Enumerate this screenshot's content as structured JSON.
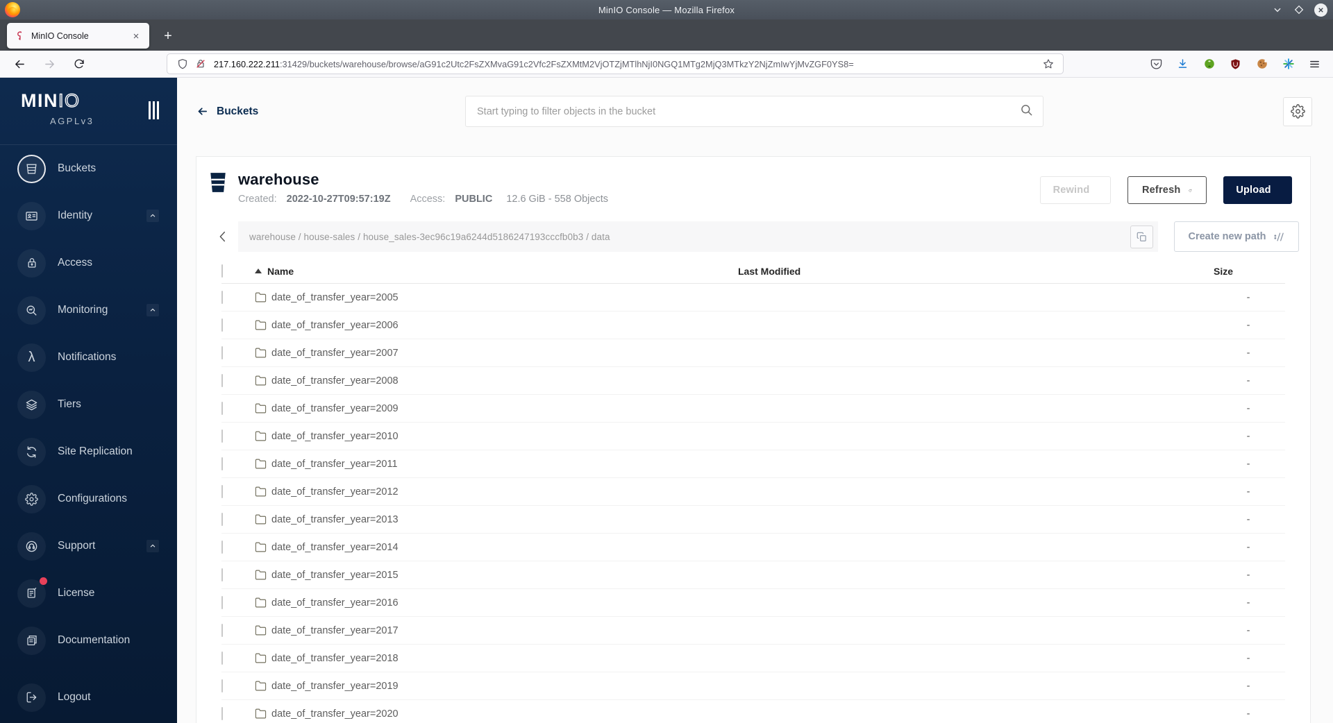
{
  "window": {
    "title": "MinIO Console — Mozilla Firefox"
  },
  "browser": {
    "tab_title": "MinIO Console",
    "new_tab_label": "+",
    "url_host": "217.160.222.211",
    "url_rest": ":31429/buckets/warehouse/browse/aG91c2Utc2FsZXMvaG91c2Vfc2FsZXMtM2VjOTZjMTlhNjI0NGQ1MTg2MjQ3MTkzY2NjZmIwYjMvZGF0YS8="
  },
  "sidebar": {
    "logo_primary": "MIN",
    "logo_secondary": "IO",
    "license_tag": "AGPLv3",
    "lambda_glyph": "λ",
    "items": [
      {
        "label": "Buckets"
      },
      {
        "label": "Identity"
      },
      {
        "label": "Access"
      },
      {
        "label": "Monitoring"
      },
      {
        "label": "Notifications"
      },
      {
        "label": "Tiers"
      },
      {
        "label": "Site Replication"
      },
      {
        "label": "Configurations"
      },
      {
        "label": "Support"
      },
      {
        "label": "License"
      },
      {
        "label": "Documentation"
      },
      {
        "label": "Logout"
      }
    ]
  },
  "topbar": {
    "back_label": "Buckets",
    "search_placeholder": "Start typing to filter objects in the bucket"
  },
  "bucket": {
    "name": "warehouse",
    "created_label": "Created:",
    "created_value": "2022-10-27T09:57:19Z",
    "access_label": "Access:",
    "access_value": "PUBLIC",
    "summary": "12.6 GiB - 558 Objects",
    "rewind_label": "Rewind",
    "refresh_label": "Refresh",
    "upload_label": "Upload"
  },
  "browse": {
    "path": "warehouse / house-sales / house_sales-3ec96c19a6244d5186247193cccfb0b3 / data",
    "create_path_label": "Create new path"
  },
  "objects_table": {
    "col_name": "Name",
    "col_modified": "Last Modified",
    "col_size": "Size",
    "rows": [
      {
        "name": "date_of_transfer_year=2005",
        "size": "-"
      },
      {
        "name": "date_of_transfer_year=2006",
        "size": "-"
      },
      {
        "name": "date_of_transfer_year=2007",
        "size": "-"
      },
      {
        "name": "date_of_transfer_year=2008",
        "size": "-"
      },
      {
        "name": "date_of_transfer_year=2009",
        "size": "-"
      },
      {
        "name": "date_of_transfer_year=2010",
        "size": "-"
      },
      {
        "name": "date_of_transfer_year=2011",
        "size": "-"
      },
      {
        "name": "date_of_transfer_year=2012",
        "size": "-"
      },
      {
        "name": "date_of_transfer_year=2013",
        "size": "-"
      },
      {
        "name": "date_of_transfer_year=2014",
        "size": "-"
      },
      {
        "name": "date_of_transfer_year=2015",
        "size": "-"
      },
      {
        "name": "date_of_transfer_year=2016",
        "size": "-"
      },
      {
        "name": "date_of_transfer_year=2017",
        "size": "-"
      },
      {
        "name": "date_of_transfer_year=2018",
        "size": "-"
      },
      {
        "name": "date_of_transfer_year=2019",
        "size": "-"
      },
      {
        "name": "date_of_transfer_year=2020",
        "size": "-"
      }
    ]
  }
}
